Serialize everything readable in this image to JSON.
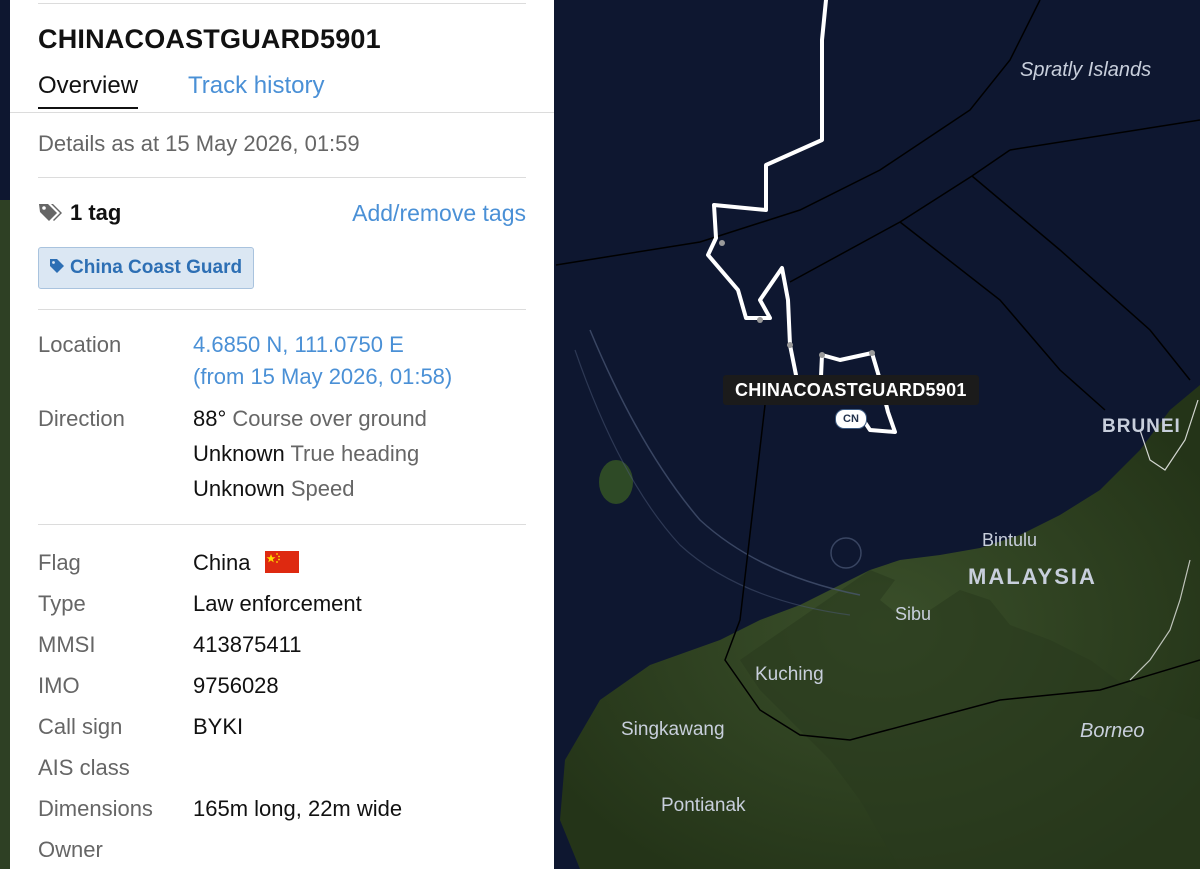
{
  "panel": {
    "vessel_name": "CHINACOASTGUARD5901",
    "tabs": [
      {
        "label": "Overview",
        "active": true
      },
      {
        "label": "Track history",
        "active": false
      }
    ],
    "details_as_at": "Details as at 15 May 2026, 01:59",
    "tags": {
      "icon": "tag-icon",
      "count_label": "1 tag",
      "add_remove_label": "Add/remove tags",
      "items": [
        "China Coast Guard"
      ]
    },
    "location": {
      "label": "Location",
      "coords": "4.6850 N, 111.0750 E",
      "from": "(from 15 May 2026, 01:58)"
    },
    "direction": {
      "label": "Direction",
      "rows": [
        {
          "value": "88°",
          "desc": "Course over ground"
        },
        {
          "value": "Unknown",
          "desc": "True heading"
        },
        {
          "value": "Unknown",
          "desc": "Speed"
        }
      ]
    },
    "details": [
      {
        "label": "Flag",
        "value": "China"
      },
      {
        "label": "Type",
        "value": "Law enforcement"
      },
      {
        "label": "MMSI",
        "value": "413875411"
      },
      {
        "label": "IMO",
        "value": "9756028"
      },
      {
        "label": "Call sign",
        "value": "BYKI"
      },
      {
        "label": "AIS class",
        "value": ""
      },
      {
        "label": "Dimensions",
        "value": "165m long, 22m wide"
      },
      {
        "label": "Owner",
        "value": ""
      }
    ]
  },
  "map": {
    "vessel_label": "CHINACOASTGUARD5901",
    "vessel_badge": "CN",
    "place_labels": {
      "spratly": "Spratly Islands",
      "brunei": "BRUNEI",
      "bintulu": "Bintulu",
      "malaysia": "MALAYSIA",
      "sibu": "Sibu",
      "kuching": "Kuching",
      "singkawang": "Singkawang",
      "borneo": "Borneo",
      "pontianak": "Pontianak"
    }
  },
  "colors": {
    "link": "#4a90d6",
    "ocean": "#0e1730",
    "land": "#2c3d22",
    "track": "#ffffff",
    "flag_red": "#de2910",
    "flag_star": "#ffde00"
  }
}
